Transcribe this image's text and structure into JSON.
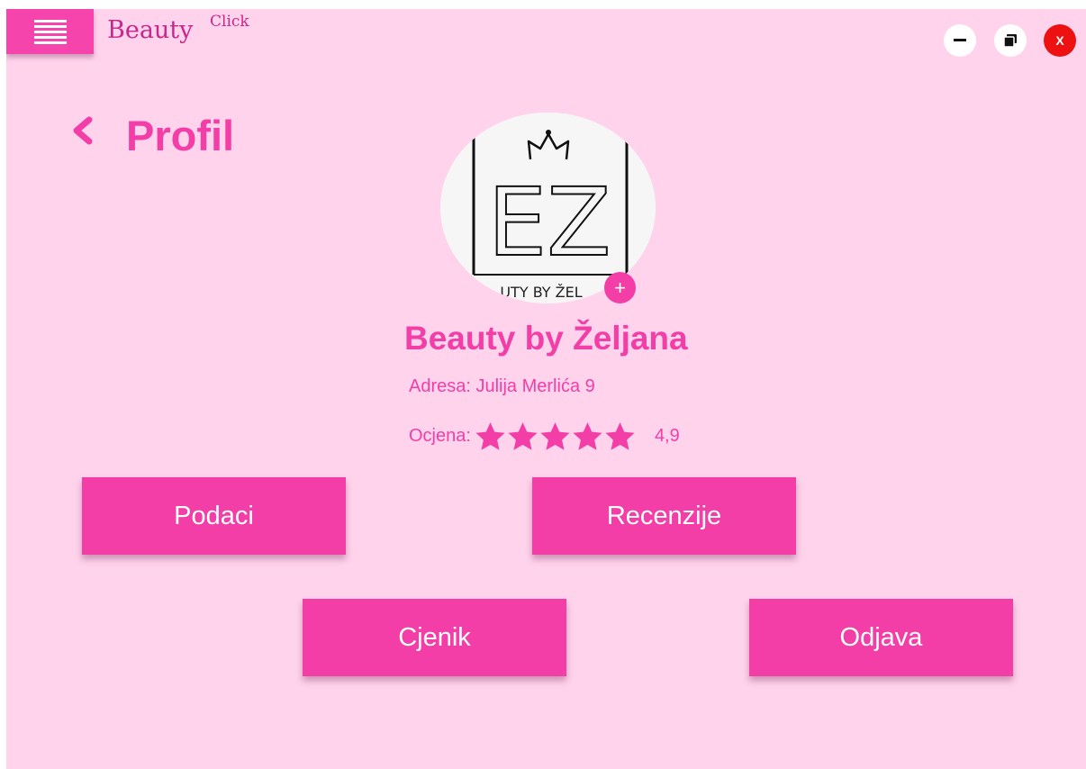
{
  "app": {
    "logo_main": "Beauty",
    "logo_sup": "Click",
    "window_controls": {
      "minimize_icon": "minimize-icon",
      "restore_icon": "restore-icon",
      "close_label": "X"
    }
  },
  "header": {
    "menu_icon": "hamburger-icon",
    "back_icon": "chevron-left-icon",
    "title": "Profil"
  },
  "profile": {
    "logo_letters": "EZ",
    "logo_caption": "UTY BY ŽEL",
    "add_photo_label": "+",
    "name": "Beauty by Željana",
    "address": "Adresa: Julija Merlića 9",
    "rating_label": "Ocjena:",
    "rating_stars": 5,
    "rating_value": "4,9"
  },
  "actions": {
    "podaci": "Podaci",
    "recenzije": "Recenzije",
    "cjenik": "Cjenik",
    "odjava": "Odjava"
  },
  "colors": {
    "background": "#ffd3ec",
    "accent": "#f23ea6",
    "close": "#ee1111",
    "logo": "#c8288b"
  }
}
